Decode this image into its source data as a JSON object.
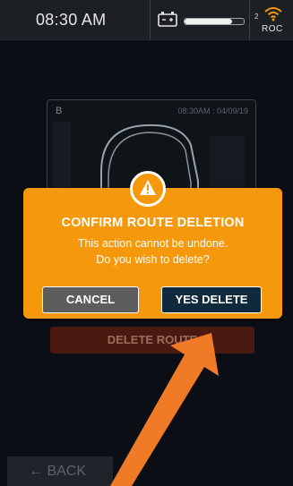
{
  "status_bar": {
    "time": "08:30 AM",
    "battery_icon": "battery-icon",
    "battery_level_percent": 80,
    "signal_number": "2",
    "wifi_icon": "wifi-icon",
    "network_label": "ROC"
  },
  "route_preview": {
    "label": "B",
    "timestamp": "08:30AM : 04/09/19"
  },
  "buttons": {
    "delete_route": "DELETE ROUTE",
    "back": "← BACK"
  },
  "dialog": {
    "icon": "warning-icon",
    "title": "CONFIRM ROUTE DELETION",
    "message_line1": "This action cannot be undone.",
    "message_line2": "Do you wish to delete?",
    "cancel_label": "CANCEL",
    "confirm_label": "YES DELETE"
  },
  "colors": {
    "dialog_bg": "#f5980b",
    "confirm_button": "#0f2a3d",
    "cancel_button": "#5d5d5d",
    "annotation_arrow": "#f07a25"
  }
}
